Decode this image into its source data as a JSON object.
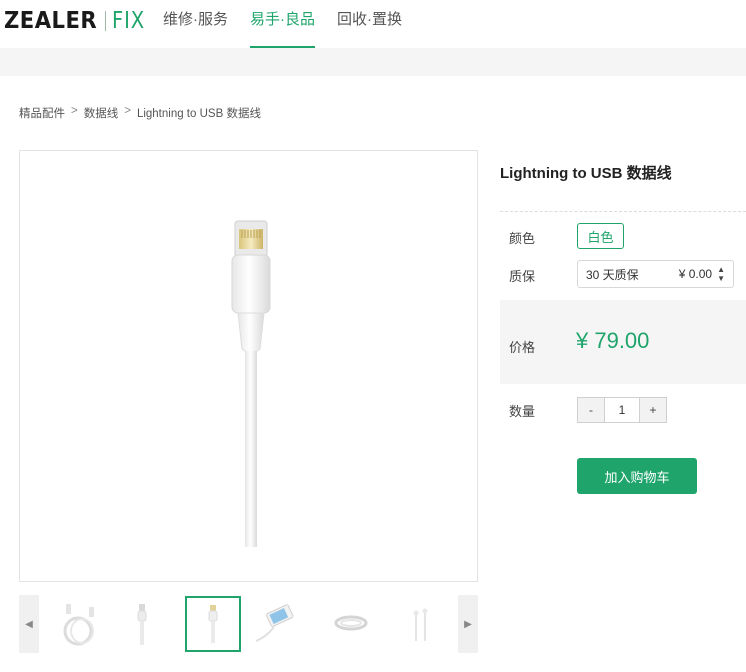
{
  "brand": {
    "main": "ZEALER",
    "sub": "FIX"
  },
  "nav": [
    {
      "label": "维修·服务",
      "active": false
    },
    {
      "label": "易手·良品",
      "active": true
    },
    {
      "label": "回收·置换",
      "active": false
    }
  ],
  "breadcrumb": [
    "精品配件",
    ">",
    "数据线",
    ">",
    "Lightning to USB 数据线"
  ],
  "product": {
    "title": "Lightning to USB 数据线",
    "color_label": "颜色",
    "color_option": "白色",
    "warranty_label": "质保",
    "warranty_option": "30 天质保",
    "warranty_price": "¥ 0.00",
    "price_label": "价格",
    "price": "¥ 79.00",
    "qty_label": "数量",
    "qty_minus": "-",
    "qty_value": "1",
    "qty_plus": "+",
    "cart_button": "加入购物车"
  },
  "thumbnails": {
    "active_index": 2,
    "items": [
      "cable-coil-icon",
      "cable-plug-icon",
      "lightning-cable-icon",
      "iphone-with-cable-icon",
      "cable-bundle-icon",
      "earbud-cable-icon"
    ]
  },
  "colors": {
    "accent": "#1fa56b",
    "band": "#f5f5f5"
  }
}
